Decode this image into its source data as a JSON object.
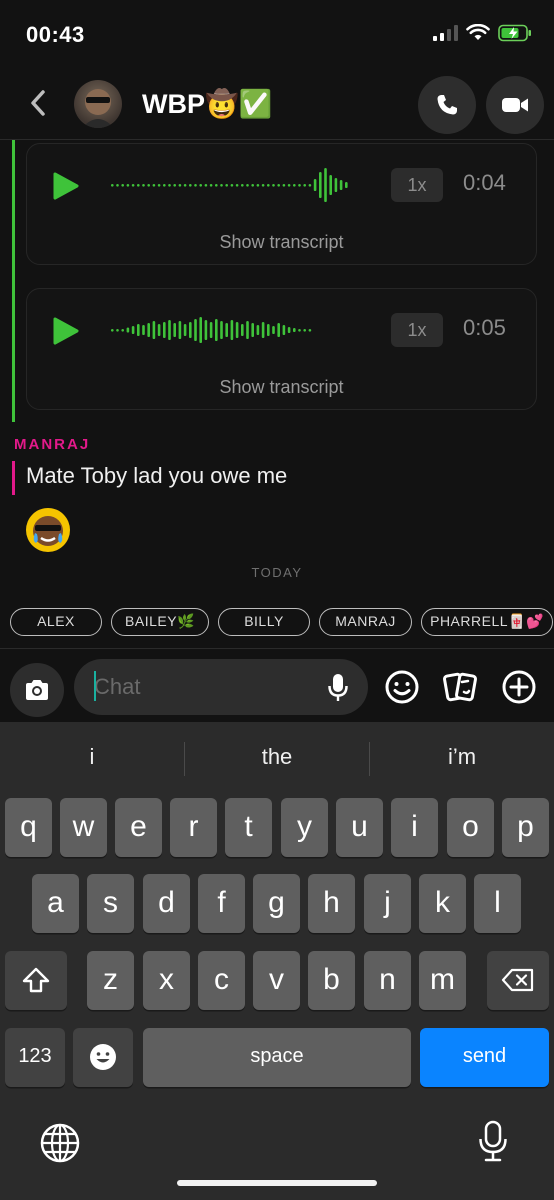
{
  "status_bar": {
    "time": "00:43"
  },
  "header": {
    "title": "WBP🤠✅",
    "back_icon": "chevron-left-icon",
    "call_icon": "phone-icon",
    "video_icon": "video-camera-icon"
  },
  "colors": {
    "accent_green": "#3fc33a",
    "sender_pink": "#e2198a",
    "send_blue": "#0a84ff"
  },
  "voice_notes": [
    {
      "speed": "1x",
      "duration": "0:04",
      "transcript_label": "Show transcript"
    },
    {
      "speed": "1x",
      "duration": "0:05",
      "transcript_label": "Show transcript"
    }
  ],
  "message": {
    "sender": "MANRAJ",
    "text": "Mate Toby lad you owe me"
  },
  "divider": "TODAY",
  "mention_chips": [
    "ALEX",
    "BAILEY🌿",
    "BILLY",
    "MANRAJ",
    "PHARRELL🀄💕"
  ],
  "input": {
    "placeholder": "Chat"
  },
  "keyboard": {
    "suggestions": [
      "i",
      "the",
      "i’m"
    ],
    "row1": [
      "q",
      "w",
      "e",
      "r",
      "t",
      "y",
      "u",
      "i",
      "o",
      "p"
    ],
    "row2": [
      "a",
      "s",
      "d",
      "f",
      "g",
      "h",
      "j",
      "k",
      "l"
    ],
    "row3": [
      "z",
      "x",
      "c",
      "v",
      "b",
      "n",
      "m"
    ],
    "numbers_label": "123",
    "space_label": "space",
    "send_label": "send"
  }
}
